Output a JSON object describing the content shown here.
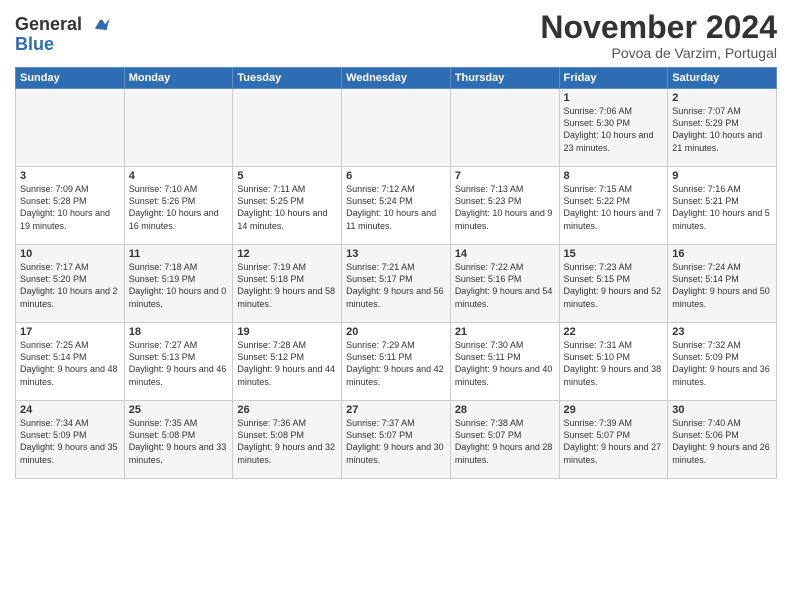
{
  "header": {
    "logo_line1": "General",
    "logo_line2": "Blue",
    "month": "November 2024",
    "location": "Povoa de Varzim, Portugal"
  },
  "weekdays": [
    "Sunday",
    "Monday",
    "Tuesday",
    "Wednesday",
    "Thursday",
    "Friday",
    "Saturday"
  ],
  "weeks": [
    [
      {
        "day": "",
        "info": ""
      },
      {
        "day": "",
        "info": ""
      },
      {
        "day": "",
        "info": ""
      },
      {
        "day": "",
        "info": ""
      },
      {
        "day": "",
        "info": ""
      },
      {
        "day": "1",
        "info": "Sunrise: 7:06 AM\nSunset: 5:30 PM\nDaylight: 10 hours and 23 minutes."
      },
      {
        "day": "2",
        "info": "Sunrise: 7:07 AM\nSunset: 5:29 PM\nDaylight: 10 hours and 21 minutes."
      }
    ],
    [
      {
        "day": "3",
        "info": "Sunrise: 7:09 AM\nSunset: 5:28 PM\nDaylight: 10 hours and 19 minutes."
      },
      {
        "day": "4",
        "info": "Sunrise: 7:10 AM\nSunset: 5:26 PM\nDaylight: 10 hours and 16 minutes."
      },
      {
        "day": "5",
        "info": "Sunrise: 7:11 AM\nSunset: 5:25 PM\nDaylight: 10 hours and 14 minutes."
      },
      {
        "day": "6",
        "info": "Sunrise: 7:12 AM\nSunset: 5:24 PM\nDaylight: 10 hours and 11 minutes."
      },
      {
        "day": "7",
        "info": "Sunrise: 7:13 AM\nSunset: 5:23 PM\nDaylight: 10 hours and 9 minutes."
      },
      {
        "day": "8",
        "info": "Sunrise: 7:15 AM\nSunset: 5:22 PM\nDaylight: 10 hours and 7 minutes."
      },
      {
        "day": "9",
        "info": "Sunrise: 7:16 AM\nSunset: 5:21 PM\nDaylight: 10 hours and 5 minutes."
      }
    ],
    [
      {
        "day": "10",
        "info": "Sunrise: 7:17 AM\nSunset: 5:20 PM\nDaylight: 10 hours and 2 minutes."
      },
      {
        "day": "11",
        "info": "Sunrise: 7:18 AM\nSunset: 5:19 PM\nDaylight: 10 hours and 0 minutes."
      },
      {
        "day": "12",
        "info": "Sunrise: 7:19 AM\nSunset: 5:18 PM\nDaylight: 9 hours and 58 minutes."
      },
      {
        "day": "13",
        "info": "Sunrise: 7:21 AM\nSunset: 5:17 PM\nDaylight: 9 hours and 56 minutes."
      },
      {
        "day": "14",
        "info": "Sunrise: 7:22 AM\nSunset: 5:16 PM\nDaylight: 9 hours and 54 minutes."
      },
      {
        "day": "15",
        "info": "Sunrise: 7:23 AM\nSunset: 5:15 PM\nDaylight: 9 hours and 52 minutes."
      },
      {
        "day": "16",
        "info": "Sunrise: 7:24 AM\nSunset: 5:14 PM\nDaylight: 9 hours and 50 minutes."
      }
    ],
    [
      {
        "day": "17",
        "info": "Sunrise: 7:25 AM\nSunset: 5:14 PM\nDaylight: 9 hours and 48 minutes."
      },
      {
        "day": "18",
        "info": "Sunrise: 7:27 AM\nSunset: 5:13 PM\nDaylight: 9 hours and 46 minutes."
      },
      {
        "day": "19",
        "info": "Sunrise: 7:28 AM\nSunset: 5:12 PM\nDaylight: 9 hours and 44 minutes."
      },
      {
        "day": "20",
        "info": "Sunrise: 7:29 AM\nSunset: 5:11 PM\nDaylight: 9 hours and 42 minutes."
      },
      {
        "day": "21",
        "info": "Sunrise: 7:30 AM\nSunset: 5:11 PM\nDaylight: 9 hours and 40 minutes."
      },
      {
        "day": "22",
        "info": "Sunrise: 7:31 AM\nSunset: 5:10 PM\nDaylight: 9 hours and 38 minutes."
      },
      {
        "day": "23",
        "info": "Sunrise: 7:32 AM\nSunset: 5:09 PM\nDaylight: 9 hours and 36 minutes."
      }
    ],
    [
      {
        "day": "24",
        "info": "Sunrise: 7:34 AM\nSunset: 5:09 PM\nDaylight: 9 hours and 35 minutes."
      },
      {
        "day": "25",
        "info": "Sunrise: 7:35 AM\nSunset: 5:08 PM\nDaylight: 9 hours and 33 minutes."
      },
      {
        "day": "26",
        "info": "Sunrise: 7:36 AM\nSunset: 5:08 PM\nDaylight: 9 hours and 32 minutes."
      },
      {
        "day": "27",
        "info": "Sunrise: 7:37 AM\nSunset: 5:07 PM\nDaylight: 9 hours and 30 minutes."
      },
      {
        "day": "28",
        "info": "Sunrise: 7:38 AM\nSunset: 5:07 PM\nDaylight: 9 hours and 28 minutes."
      },
      {
        "day": "29",
        "info": "Sunrise: 7:39 AM\nSunset: 5:07 PM\nDaylight: 9 hours and 27 minutes."
      },
      {
        "day": "30",
        "info": "Sunrise: 7:40 AM\nSunset: 5:06 PM\nDaylight: 9 hours and 26 minutes."
      }
    ]
  ]
}
